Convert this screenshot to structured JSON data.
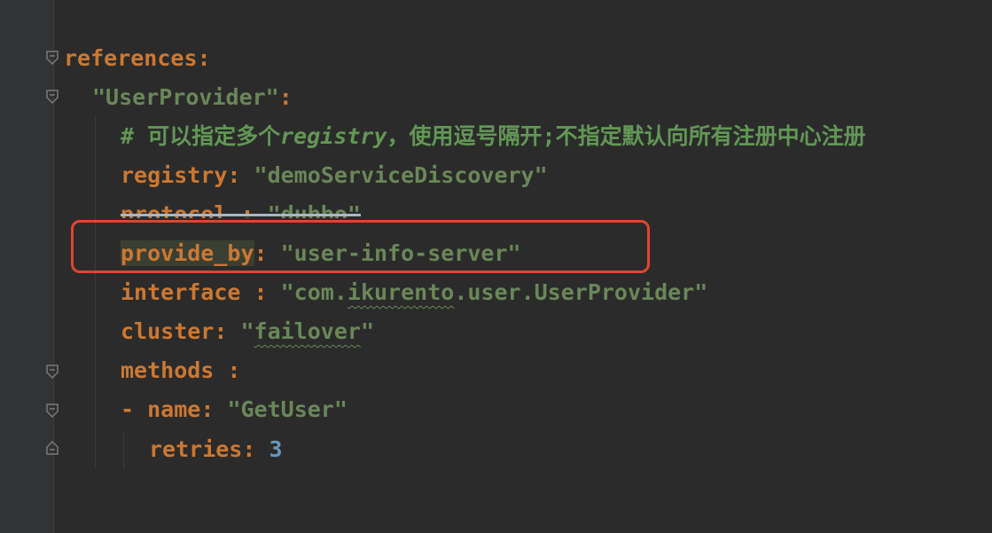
{
  "editor": {
    "language": "yaml",
    "lines": [
      {
        "indent": "",
        "tokens": [
          {
            "t": "key",
            "v": "references"
          },
          {
            "t": "punc",
            "v": ":"
          }
        ]
      },
      {
        "indent": "  ",
        "tokens": [
          {
            "t": "str",
            "v": "\"UserProvider\""
          },
          {
            "t": "punc",
            "v": ":"
          }
        ]
      },
      {
        "indent": "    ",
        "tokens": [
          {
            "t": "cmt",
            "v": "# 可以指定多个registry，使用逗号隔开;不指定默认向所有注册中心注册"
          }
        ]
      },
      {
        "indent": "    ",
        "tokens": [
          {
            "t": "key",
            "v": "registry"
          },
          {
            "t": "punc",
            "v": ": "
          },
          {
            "t": "str",
            "v": "\"demoServiceDiscovery\""
          }
        ]
      },
      {
        "indent": "    ",
        "tokens": [
          {
            "t": "key",
            "v": "protocol "
          },
          {
            "t": "punc",
            "v": ": "
          },
          {
            "t": "str",
            "v": "\"dubbo\""
          }
        ]
      },
      {
        "indent": "    ",
        "tokens": [
          {
            "t": "key",
            "v": "provide_by"
          },
          {
            "t": "punc",
            "v": ": "
          },
          {
            "t": "str",
            "v": "\"user-info-server\""
          }
        ]
      },
      {
        "indent": "    ",
        "tokens": [
          {
            "t": "key",
            "v": "interface "
          },
          {
            "t": "punc",
            "v": ": "
          },
          {
            "t": "str",
            "v": "\"com.ikurento.user.UserProvider\""
          }
        ]
      },
      {
        "indent": "    ",
        "tokens": [
          {
            "t": "key",
            "v": "cluster"
          },
          {
            "t": "punc",
            "v": ": "
          },
          {
            "t": "str",
            "v": "\"failover\""
          }
        ]
      },
      {
        "indent": "    ",
        "tokens": [
          {
            "t": "key",
            "v": "methods "
          },
          {
            "t": "punc",
            "v": ":"
          }
        ]
      },
      {
        "indent": "    ",
        "tokens": [
          {
            "t": "punc",
            "v": "- "
          },
          {
            "t": "key",
            "v": "name"
          },
          {
            "t": "punc",
            "v": ": "
          },
          {
            "t": "str",
            "v": "\"GetUser\""
          }
        ]
      },
      {
        "indent": "      ",
        "tokens": [
          {
            "t": "key",
            "v": "retries"
          },
          {
            "t": "punc",
            "v": ": "
          },
          {
            "t": "num",
            "v": "3"
          }
        ]
      }
    ]
  },
  "text": {
    "l1_key": "references",
    "l1_colon": ":",
    "l2_str": "\"UserProvider\"",
    "l2_colon": ":",
    "l3_hash": "# 可以指定多个",
    "l3_it": "registry",
    "l3_rest": "，使用逗号隔开;不指定默认向所有注册中心注册",
    "l4_key": "registry",
    "l4_colon": ": ",
    "l4_str": "\"demoServiceDiscovery\"",
    "l5_key": "protocol",
    "l5_colon": " : ",
    "l5_q1": "\"",
    "l5_word": "dubbo",
    "l5_q2": "\"",
    "l6_key": "provide_by",
    "l6_colon": ": ",
    "l6_str": "\"user-info-server\"",
    "l7_key": "interface",
    "l7_colon": " : ",
    "l7_s1": "\"com.",
    "l7_word": "ikurento",
    "l7_s2": ".user.UserProvider\"",
    "l8_key": "cluster",
    "l8_colon": ": ",
    "l8_q1": "\"",
    "l8_word": "failover",
    "l8_q2": "\"",
    "l9_key": "methods",
    "l9_colon": " :",
    "l10_dash": "- ",
    "l10_key": "name",
    "l10_colon": ": ",
    "l10_str": "\"GetUser\"",
    "l11_key": "retries",
    "l11_colon": ": ",
    "l11_num": "3"
  },
  "colors": {
    "background": "#2b2b2b",
    "key": "#cc7832",
    "string": "#6a8759",
    "comment": "#629755",
    "number": "#6897bb",
    "annotation_box": "#e0452e"
  }
}
